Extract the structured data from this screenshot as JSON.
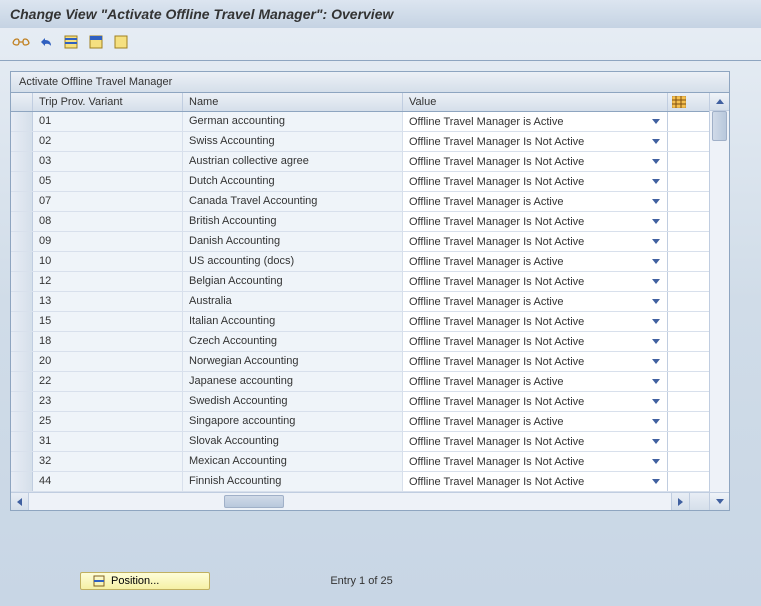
{
  "title": "Change View \"Activate Offline Travel Manager\": Overview",
  "toolbar": {
    "icons": [
      "other-view",
      "undo",
      "select-all",
      "select-block",
      "deselect"
    ]
  },
  "table": {
    "caption": "Activate Offline Travel Manager",
    "columns": {
      "variant": "Trip Prov. Variant",
      "name": "Name",
      "value": "Value"
    },
    "rows": [
      {
        "variant": "01",
        "name": "German accounting",
        "value": "Offline Travel Manager is Active"
      },
      {
        "variant": "02",
        "name": "Swiss Accounting",
        "value": "Offline Travel Manager Is Not Active"
      },
      {
        "variant": "03",
        "name": "Austrian collective agree",
        "value": "Offline Travel Manager Is Not Active"
      },
      {
        "variant": "05",
        "name": "Dutch Accounting",
        "value": "Offline Travel Manager Is Not Active"
      },
      {
        "variant": "07",
        "name": "Canada Travel Accounting",
        "value": "Offline Travel Manager is Active"
      },
      {
        "variant": "08",
        "name": "British Accounting",
        "value": "Offline Travel Manager Is Not Active"
      },
      {
        "variant": "09",
        "name": "Danish Accounting",
        "value": "Offline Travel Manager Is Not Active"
      },
      {
        "variant": "10",
        "name": "US accounting (docs)",
        "value": "Offline Travel Manager is Active"
      },
      {
        "variant": "12",
        "name": "Belgian Accounting",
        "value": "Offline Travel Manager Is Not Active"
      },
      {
        "variant": "13",
        "name": "Australia",
        "value": "Offline Travel Manager is Active"
      },
      {
        "variant": "15",
        "name": "Italian Accounting",
        "value": "Offline Travel Manager Is Not Active"
      },
      {
        "variant": "18",
        "name": "Czech Accounting",
        "value": "Offline Travel Manager Is Not Active"
      },
      {
        "variant": "20",
        "name": "Norwegian Accounting",
        "value": "Offline Travel Manager Is Not Active"
      },
      {
        "variant": "22",
        "name": "Japanese accounting",
        "value": "Offline Travel Manager is Active"
      },
      {
        "variant": "23",
        "name": "Swedish Accounting",
        "value": "Offline Travel Manager Is Not Active"
      },
      {
        "variant": "25",
        "name": "Singapore accounting",
        "value": "Offline Travel Manager is Active"
      },
      {
        "variant": "31",
        "name": "Slovak Accounting",
        "value": "Offline Travel Manager Is Not Active"
      },
      {
        "variant": "32",
        "name": "Mexican Accounting",
        "value": "Offline Travel Manager Is Not Active"
      },
      {
        "variant": "44",
        "name": "Finnish Accounting",
        "value": "Offline Travel Manager Is Not Active"
      }
    ]
  },
  "footer": {
    "position_label": "Position...",
    "entry_status": "Entry 1 of 25"
  }
}
